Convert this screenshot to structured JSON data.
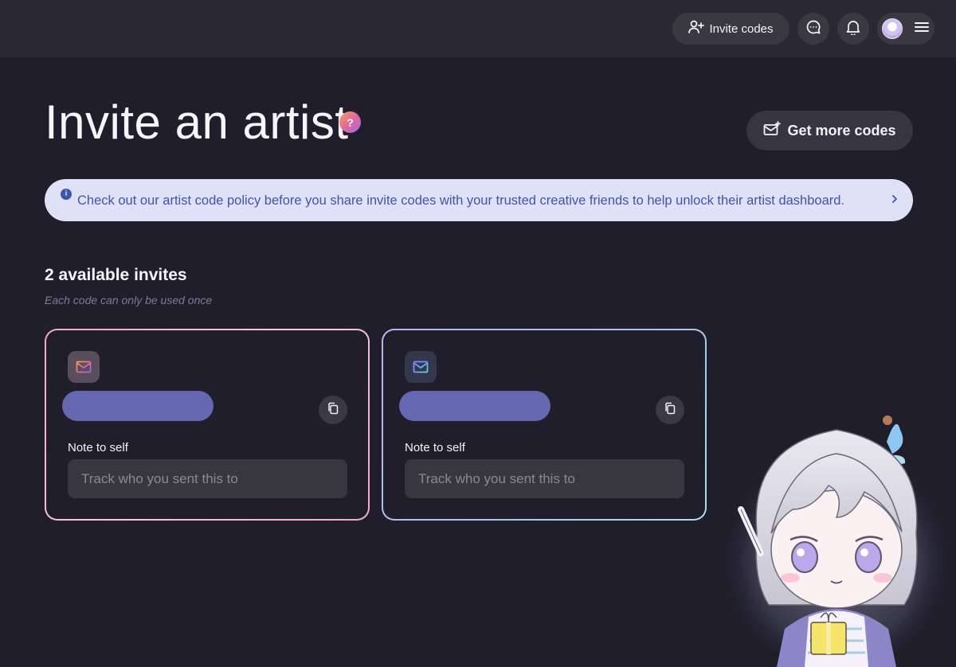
{
  "header": {
    "invite_codes_label": "Invite codes",
    "icons": [
      "user-plus-icon",
      "chat-bubble-icon",
      "bell-icon",
      "avatar",
      "hamburger-menu-icon"
    ]
  },
  "page": {
    "title": "Invite an artist",
    "help_badge": "?",
    "get_more_codes_label": "Get more codes"
  },
  "policy_banner": {
    "text": "Check out our artist code policy before you share invite codes with your trusted creative friends to help unlock their artist dashboard.",
    "info_glyph": "i",
    "chevron": "›"
  },
  "invites": {
    "title": "2 available invites",
    "subtitle": "Each code can only be used once",
    "cards": [
      {
        "note_label": "Note to self",
        "note_placeholder": "Track who you sent this to",
        "border": "pink"
      },
      {
        "note_label": "Note to self",
        "note_placeholder": "Track who you sent this to",
        "border": "blue"
      }
    ]
  },
  "colors": {
    "background": "#1f1e2a",
    "banner_bg": "#dfe2f6",
    "banner_text": "#3f55a8",
    "redaction": "#6567b0",
    "card_pink_border": "#f0a8c8",
    "card_blue_border": "#a5c6ee"
  }
}
